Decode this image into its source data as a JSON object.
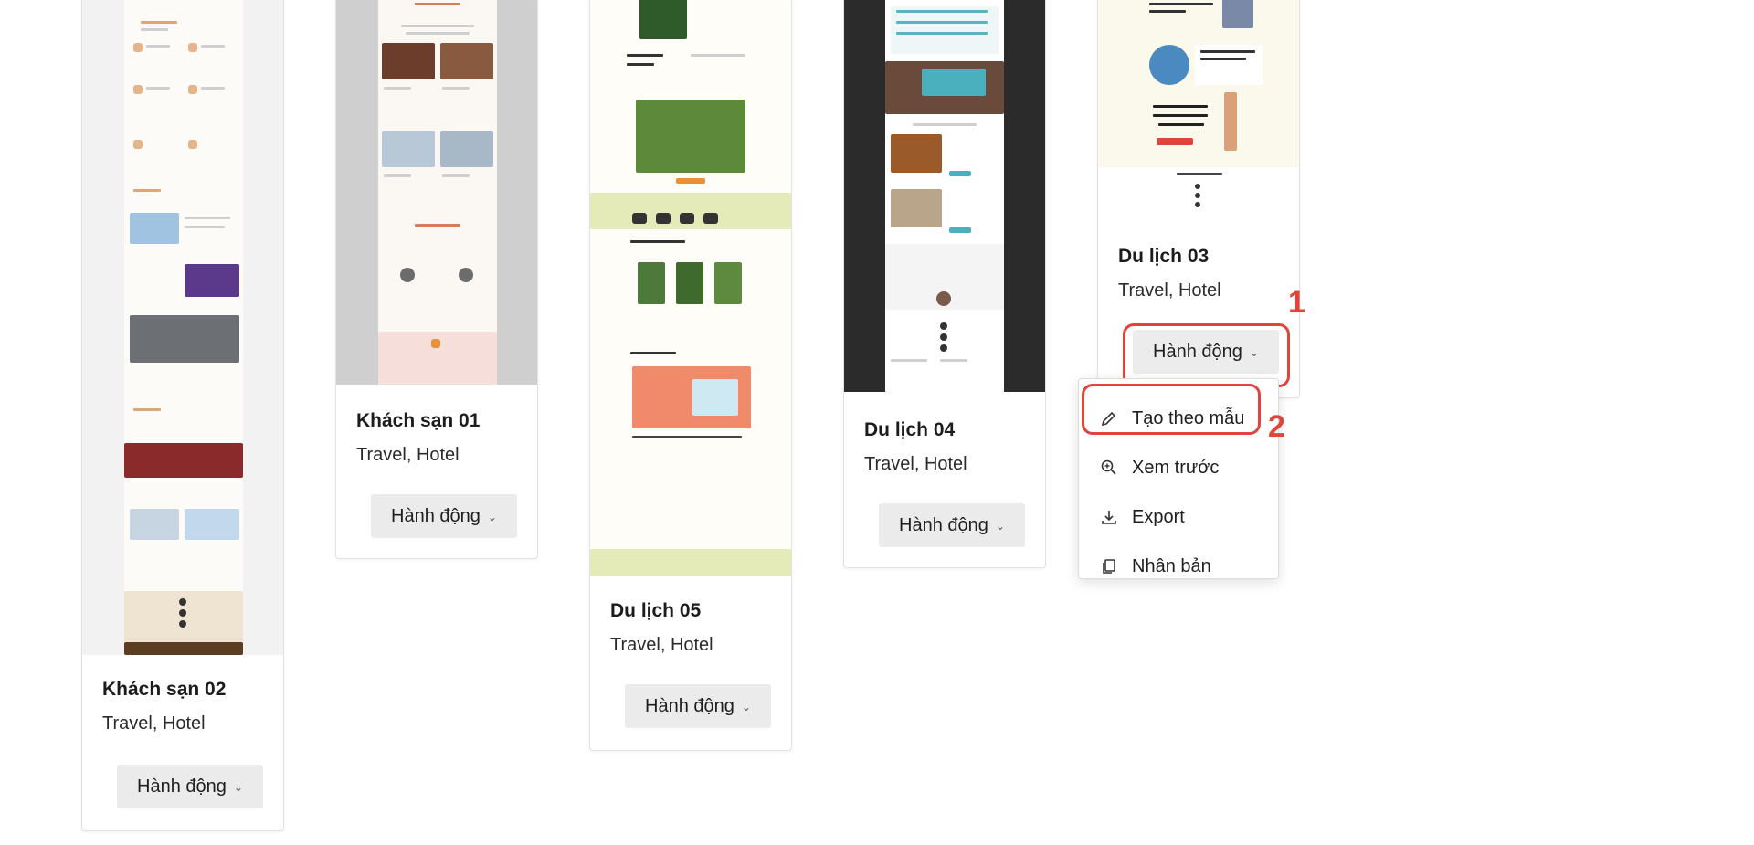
{
  "cards": [
    {
      "title": "Khách sạn 02",
      "tags": "Travel, Hotel",
      "action_label": "Hành động"
    },
    {
      "title": "Khách sạn 01",
      "tags": "Travel, Hotel",
      "action_label": "Hành động"
    },
    {
      "title": "Du lịch 05",
      "tags": "Travel, Hotel",
      "action_label": "Hành động"
    },
    {
      "title": "Du lịch 04",
      "tags": "Travel, Hotel",
      "action_label": "Hành động"
    },
    {
      "title": "Du lịch 03",
      "tags": "Travel, Hotel",
      "action_label": "Hành động"
    }
  ],
  "dropdown": {
    "items": [
      {
        "label": "Tạo theo mẫu",
        "icon": "pencil-icon"
      },
      {
        "label": "Xem trước",
        "icon": "zoom-in-icon"
      },
      {
        "label": "Export",
        "icon": "download-icon"
      },
      {
        "label": "Nhân bản",
        "icon": "duplicate-icon"
      }
    ]
  },
  "annotations": {
    "step1": "1",
    "step2": "2"
  },
  "colors": {
    "annotation": "#e0443a",
    "button_bg": "#ebebeb",
    "accent_orange": "#e8913a"
  }
}
